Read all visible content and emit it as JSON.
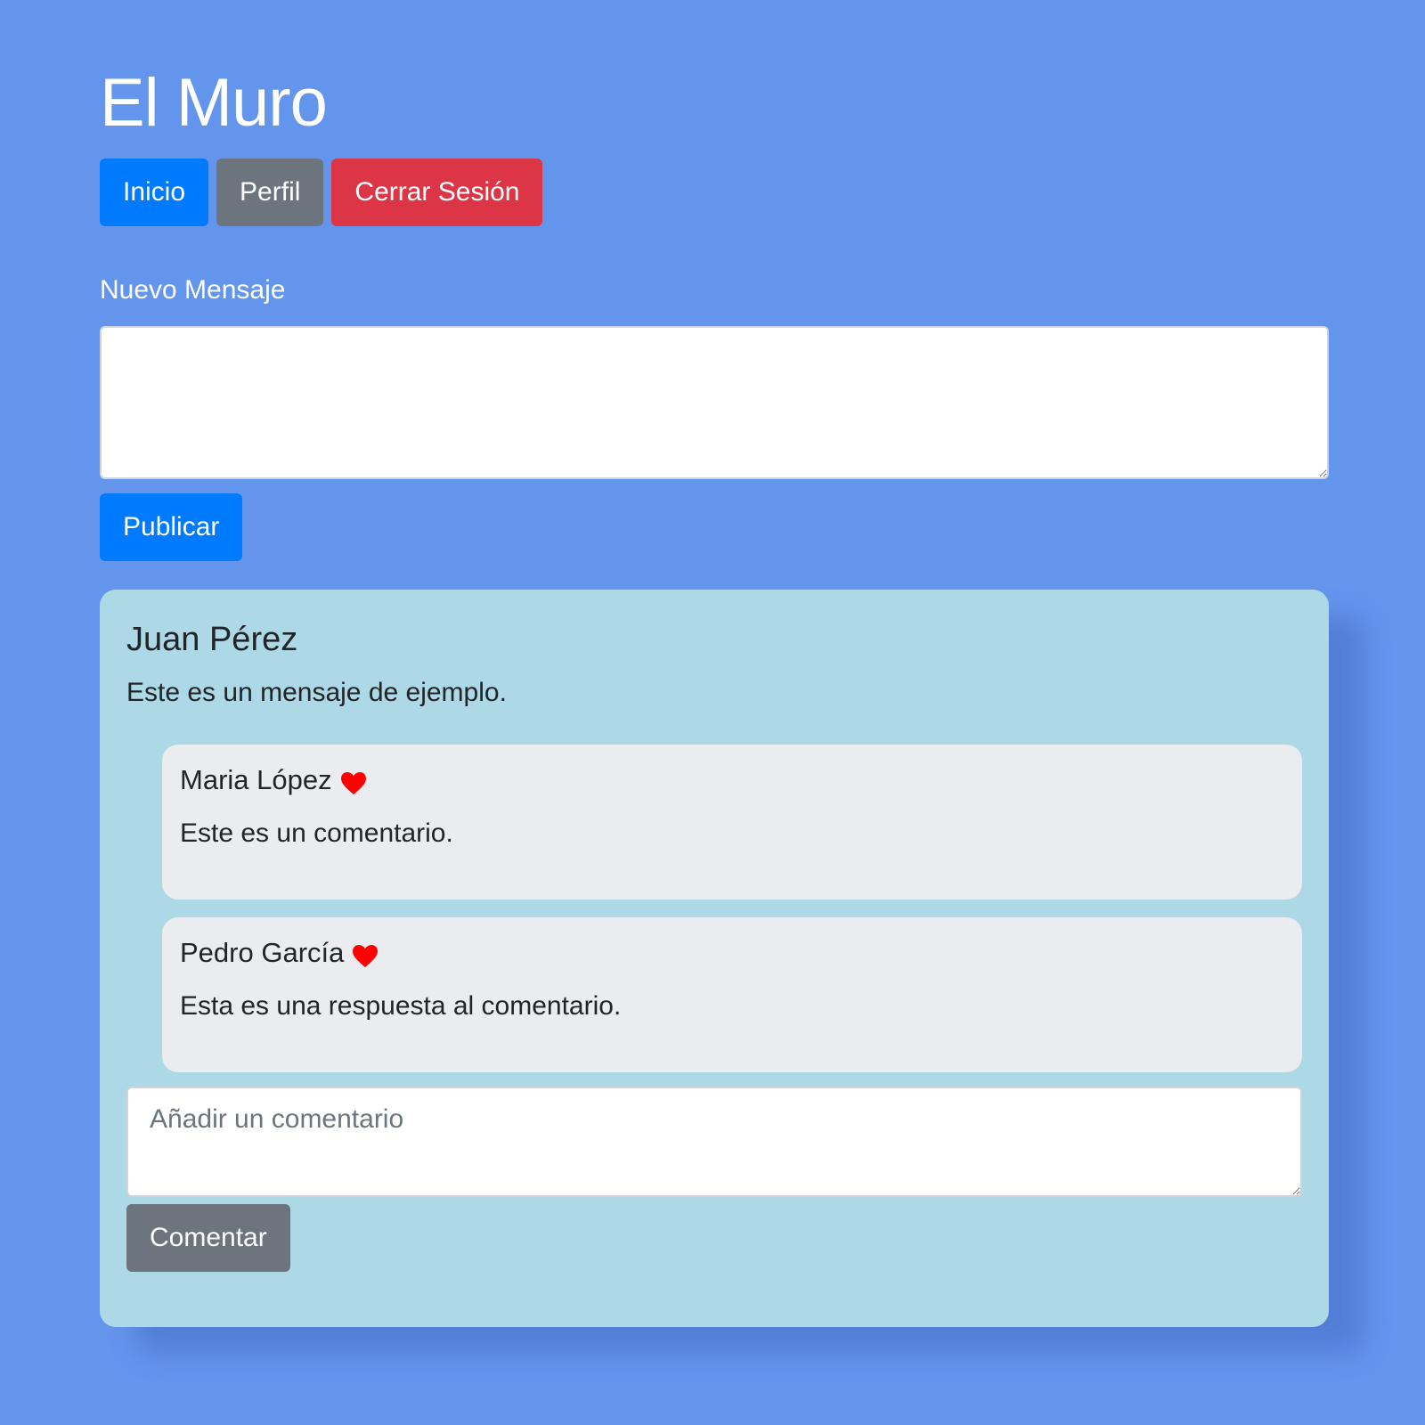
{
  "header": {
    "title": "El Muro"
  },
  "nav": {
    "home": "Inicio",
    "profile": "Perfil",
    "logout": "Cerrar Sesión"
  },
  "new_message": {
    "label": "Nuevo Mensaje",
    "value": "",
    "publish": "Publicar"
  },
  "post": {
    "author": "Juan Pérez",
    "text": "Este es un mensaje de ejemplo.",
    "comments": [
      {
        "author": "Maria López",
        "text": "Este es un comentario.",
        "icon": "heart-icon"
      },
      {
        "author": "Pedro García",
        "text": "Esta es una respuesta al comentario.",
        "icon": "heart-icon"
      }
    ],
    "comment_placeholder": "Añadir un comentario",
    "comment_button": "Comentar"
  },
  "colors": {
    "background": "#6495ed",
    "primary": "#007bff",
    "secondary": "#6c757d",
    "danger": "#dc3545",
    "post_card": "#add8e6",
    "comment_card": "#ebecf0",
    "heart": "#ff0000"
  }
}
